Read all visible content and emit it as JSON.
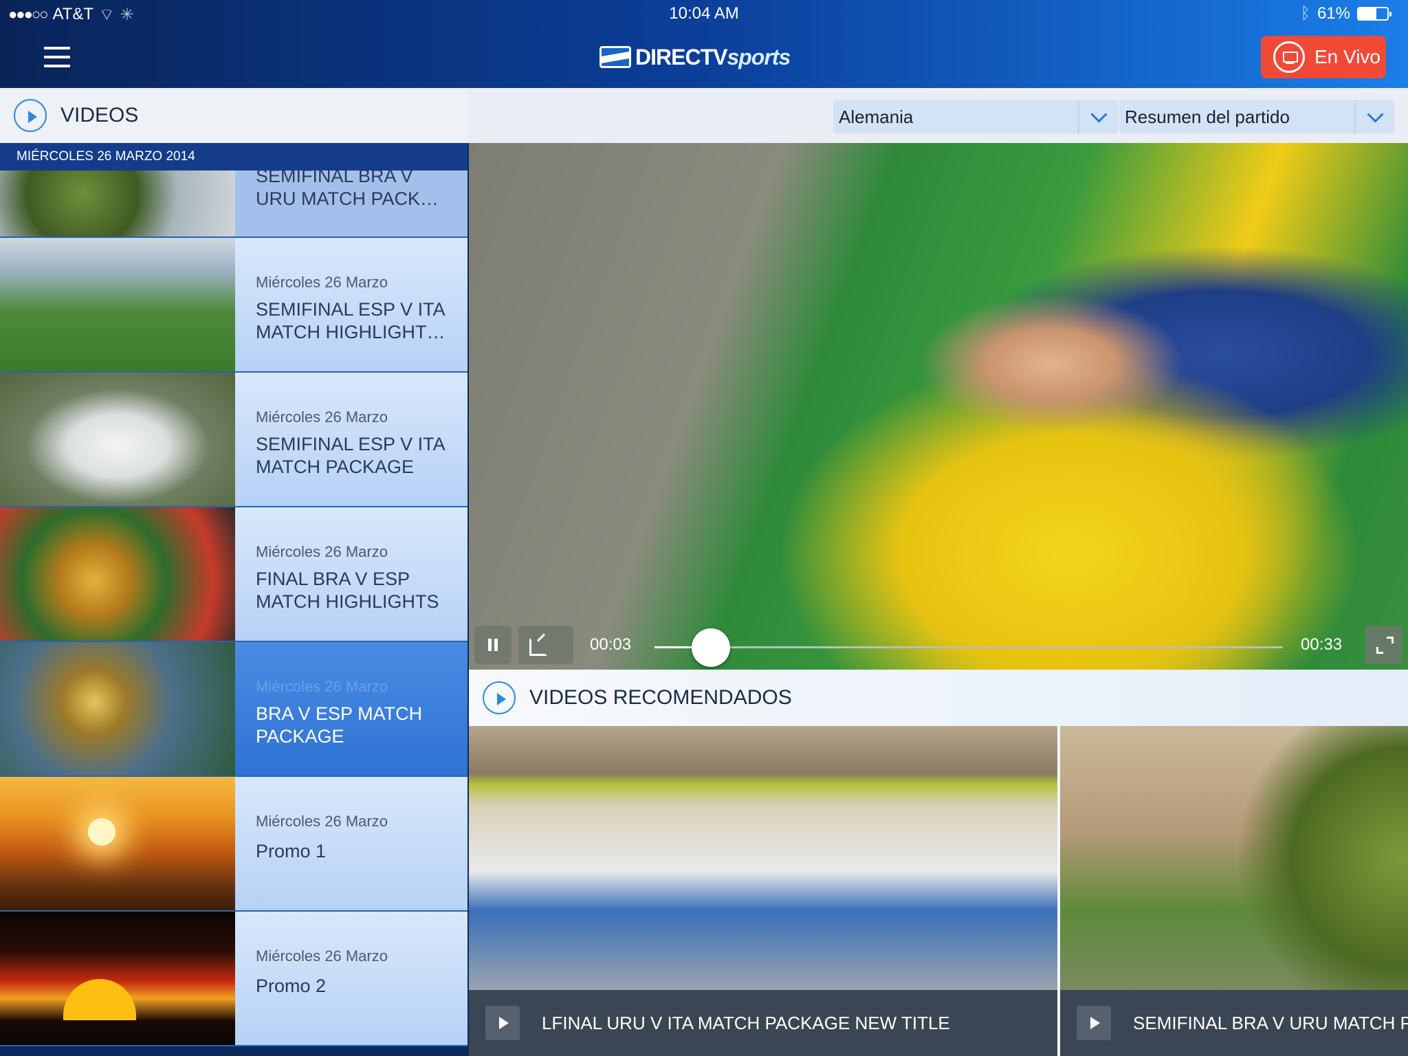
{
  "status_bar": {
    "signal": "●●●○○",
    "carrier": "AT&T",
    "time": "10:04 AM",
    "battery_pct": "61%",
    "battery_level": 0.61
  },
  "header": {
    "logo_main": "DIRECTV",
    "logo_sports": "sports",
    "live_label": "En Vivo"
  },
  "sidebar": {
    "title": "VIDEOS",
    "date_header": "MIÉRCOLES 26 MARZO 2014",
    "items": [
      {
        "date": "",
        "title": "SEMIFINAL BRA V URU MATCH PACK…",
        "thumb": "hulk"
      },
      {
        "date": "Miércoles 26 Marzo",
        "title": "SEMIFINAL ESP V ITA MATCH HIGHLIGHT…",
        "thumb": "handshake"
      },
      {
        "date": "Miércoles 26 Marzo",
        "title": "SEMIFINAL ESP V ITA MATCH PACKAGE",
        "thumb": "stadium"
      },
      {
        "date": "Miércoles 26 Marzo",
        "title": "FINAL BRA V ESP MATCH HIGHLIGHTS",
        "thumb": "trophy"
      },
      {
        "date": "Miércoles 26 Marzo",
        "title": "BRA V ESP MATCH PACKAGE",
        "thumb": "trophy2",
        "active": true
      },
      {
        "date": "Miércoles 26 Marzo",
        "title": "Promo 1",
        "thumb": "sunset1"
      },
      {
        "date": "Miércoles 26 Marzo",
        "title": "Promo 2",
        "thumb": "sunset2"
      }
    ]
  },
  "filters": {
    "team": "Alemania",
    "type": "Resumen del partido"
  },
  "player": {
    "current_time": "00:03",
    "duration": "00:33",
    "progress": 0.09
  },
  "recommended": {
    "title": "VIDEOS RECOMENDADOS",
    "cards": [
      {
        "title": "LFINAL URU V ITA MATCH PACKAGE NEW TITLE"
      },
      {
        "title": "SEMIFINAL BRA V URU MATCH PACKAGE"
      }
    ]
  },
  "colors": {
    "accent": "#2a8be0",
    "live": "#f04a37",
    "header_dark": "#0a2459"
  }
}
